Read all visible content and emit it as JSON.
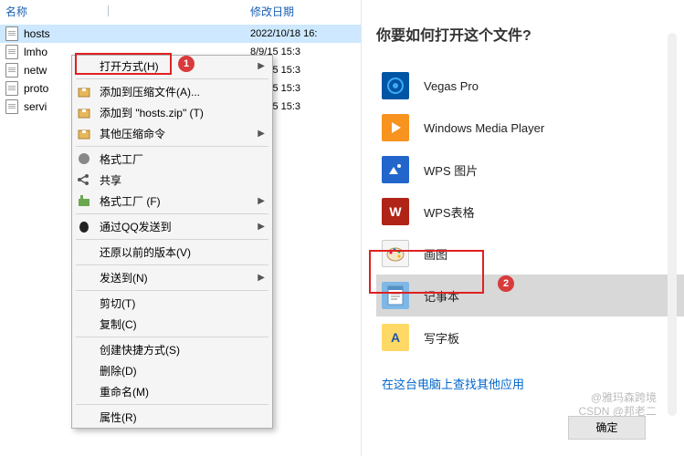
{
  "explorer": {
    "columns": {
      "name": "名称",
      "date": "修改日期"
    },
    "files": [
      {
        "name": "hosts",
        "date": "2022/10/18 16:",
        "selected": true
      },
      {
        "name": "lmho",
        "date": "8/9/15 15:3"
      },
      {
        "name": "netw",
        "date": "8/9/15 15:3"
      },
      {
        "name": "proto",
        "date": "8/9/15 15:3"
      },
      {
        "name": "servi",
        "date": "8/9/15 15:3"
      }
    ]
  },
  "context_menu": {
    "items": [
      {
        "label": "打开方式(H)",
        "arrow": true,
        "icon": ""
      },
      {
        "sep": true
      },
      {
        "label": "添加到压缩文件(A)...",
        "icon": "zip"
      },
      {
        "label": "添加到 \"hosts.zip\" (T)",
        "icon": "zip"
      },
      {
        "label": "其他压缩命令",
        "arrow": true,
        "icon": "zip"
      },
      {
        "sep": true
      },
      {
        "label": "格式工厂",
        "icon": "ff"
      },
      {
        "label": "共享",
        "icon": "share"
      },
      {
        "label": "格式工厂 (F)",
        "arrow": true,
        "icon": "ff"
      },
      {
        "sep": true
      },
      {
        "label": "通过QQ发送到",
        "arrow": true,
        "icon": "qq"
      },
      {
        "sep": true
      },
      {
        "label": "还原以前的版本(V)"
      },
      {
        "sep": true
      },
      {
        "label": "发送到(N)",
        "arrow": true
      },
      {
        "sep": true
      },
      {
        "label": "剪切(T)"
      },
      {
        "label": "复制(C)"
      },
      {
        "sep": true
      },
      {
        "label": "创建快捷方式(S)"
      },
      {
        "label": "删除(D)"
      },
      {
        "label": "重命名(M)"
      },
      {
        "sep": true
      },
      {
        "label": "属性(R)"
      }
    ]
  },
  "open_with": {
    "title": "你要如何打开这个文件?",
    "apps": [
      {
        "label": "Vegas Pro",
        "id": "vegas"
      },
      {
        "label": "Windows Media Player",
        "id": "wmp"
      },
      {
        "label": "WPS 图片",
        "id": "wpspic"
      },
      {
        "label": "WPS表格",
        "id": "wpssheet"
      },
      {
        "label": "画图",
        "id": "paint"
      },
      {
        "label": "记事本",
        "id": "notepad",
        "selected": true
      },
      {
        "label": "写字板",
        "id": "wordpad"
      }
    ],
    "more": "在这台电脑上查找其他应用",
    "ok": "确定"
  },
  "badges": {
    "b1": "1",
    "b2": "2"
  },
  "watermark": {
    "line1": "@雅玛森跨境",
    "line2": "CSDN @邦老二"
  }
}
